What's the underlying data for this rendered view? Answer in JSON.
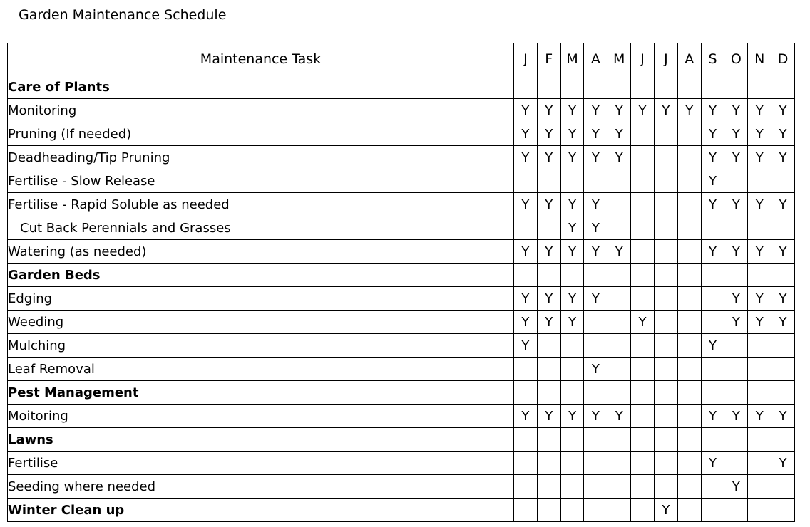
{
  "document": {
    "title": "Garden Maintenance Schedule"
  },
  "table": {
    "task_column_header": "Maintenance Task",
    "month_headers": [
      "J",
      "F",
      "M",
      "A",
      "M",
      "J",
      "J",
      "A",
      "S",
      "O",
      "N",
      "D"
    ],
    "mark_symbol": "Y",
    "rows": [
      {
        "label": "Care of Plants",
        "type": "section",
        "indent": false,
        "marks": [
          "",
          "",
          "",
          "",
          "",
          "",
          "",
          "",
          "",
          "",
          "",
          ""
        ]
      },
      {
        "label": "Monitoring",
        "type": "task",
        "indent": false,
        "marks": [
          "Y",
          "Y",
          "Y",
          "Y",
          "Y",
          "Y",
          "Y",
          "Y",
          "Y",
          "Y",
          "Y",
          "Y"
        ]
      },
      {
        "label": "Pruning (If needed)",
        "type": "task",
        "indent": false,
        "marks": [
          "Y",
          "Y",
          "Y",
          "Y",
          "Y",
          "",
          "",
          "",
          "Y",
          "Y",
          "Y",
          "Y"
        ]
      },
      {
        "label": "Deadheading/Tip Pruning",
        "type": "task",
        "indent": false,
        "marks": [
          "Y",
          "Y",
          "Y",
          "Y",
          "Y",
          "",
          "",
          "",
          "Y",
          "Y",
          "Y",
          "Y"
        ]
      },
      {
        "label": "Fertilise - Slow Release",
        "type": "task",
        "indent": false,
        "marks": [
          "",
          "",
          "",
          "",
          "",
          "",
          "",
          "",
          "Y",
          "",
          "",
          ""
        ]
      },
      {
        "label": "Fertilise - Rapid Soluble as needed",
        "type": "task",
        "indent": false,
        "marks": [
          "Y",
          "Y",
          "Y",
          "Y",
          "",
          "",
          "",
          "",
          "Y",
          "Y",
          "Y",
          "Y"
        ]
      },
      {
        "label": "Cut Back Perennials and Grasses",
        "type": "task",
        "indent": true,
        "marks": [
          "",
          "",
          "Y",
          "Y",
          "",
          "",
          "",
          "",
          "",
          "",
          "",
          ""
        ]
      },
      {
        "label": "Watering (as needed)",
        "type": "task",
        "indent": false,
        "marks": [
          "Y",
          "Y",
          "Y",
          "Y",
          "Y",
          "",
          "",
          "",
          "Y",
          "Y",
          "Y",
          "Y"
        ]
      },
      {
        "label": "Garden Beds",
        "type": "section",
        "indent": false,
        "marks": [
          "",
          "",
          "",
          "",
          "",
          "",
          "",
          "",
          "",
          "",
          "",
          ""
        ]
      },
      {
        "label": "Edging",
        "type": "task",
        "indent": false,
        "marks": [
          "Y",
          "Y",
          "Y",
          "Y",
          "",
          "",
          "",
          "",
          "",
          "Y",
          "Y",
          "Y"
        ]
      },
      {
        "label": "Weeding",
        "type": "task",
        "indent": false,
        "marks": [
          "Y",
          "Y",
          "Y",
          "",
          "",
          "Y",
          "",
          "",
          "",
          "Y",
          "Y",
          "Y"
        ]
      },
      {
        "label": "Mulching",
        "type": "task",
        "indent": false,
        "marks": [
          "Y",
          "",
          "",
          "",
          "",
          "",
          "",
          "",
          "Y",
          "",
          "",
          ""
        ]
      },
      {
        "label": "Leaf Removal",
        "type": "task",
        "indent": false,
        "marks": [
          "",
          "",
          "",
          "Y",
          "",
          "",
          "",
          "",
          "",
          "",
          "",
          ""
        ]
      },
      {
        "label": "Pest Management",
        "type": "section",
        "indent": false,
        "marks": [
          "",
          "",
          "",
          "",
          "",
          "",
          "",
          "",
          "",
          "",
          "",
          ""
        ]
      },
      {
        "label": "Moitoring",
        "type": "task",
        "indent": false,
        "marks": [
          "Y",
          "Y",
          "Y",
          "Y",
          "Y",
          "",
          "",
          "",
          "Y",
          "Y",
          "Y",
          "Y"
        ]
      },
      {
        "label": "Lawns",
        "type": "section",
        "indent": false,
        "marks": [
          "",
          "",
          "",
          "",
          "",
          "",
          "",
          "",
          "",
          "",
          "",
          ""
        ]
      },
      {
        "label": "Fertilise",
        "type": "task",
        "indent": false,
        "marks": [
          "",
          "",
          "",
          "",
          "",
          "",
          "",
          "",
          "Y",
          "",
          "",
          "Y"
        ]
      },
      {
        "label": "Seeding where needed",
        "type": "task",
        "indent": false,
        "marks": [
          "",
          "",
          "",
          "",
          "",
          "",
          "",
          "",
          "",
          "Y",
          "",
          ""
        ]
      },
      {
        "label": "Winter Clean up",
        "type": "section",
        "indent": false,
        "marks": [
          "",
          "",
          "",
          "",
          "",
          "",
          "Y",
          "",
          "",
          "",
          "",
          ""
        ]
      }
    ]
  },
  "colors": {
    "background": "#ffffff",
    "text": "#000000",
    "border": "#000000"
  }
}
